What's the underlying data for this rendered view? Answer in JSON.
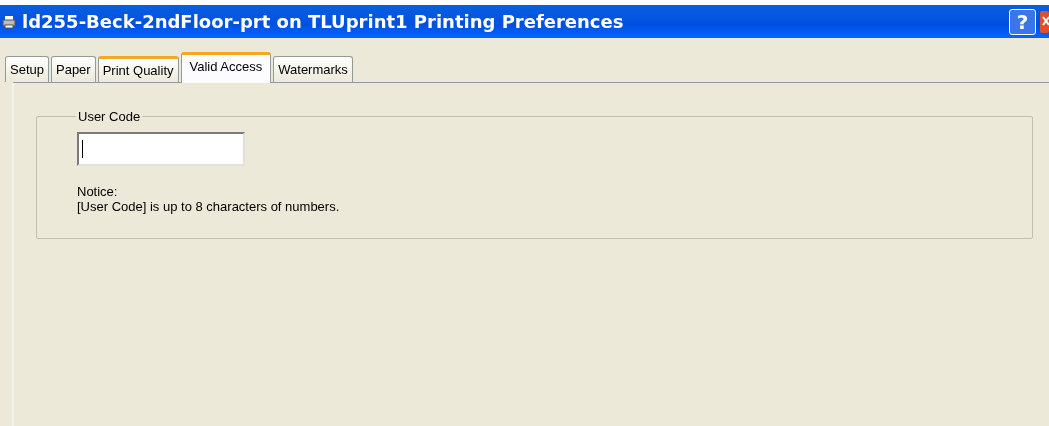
{
  "window": {
    "title": "ld255-Beck-2ndFloor-prt on TLUprint1 Printing Preferences",
    "help_button": "?"
  },
  "tabs": [
    {
      "label": "Setup",
      "selected": false,
      "hot": false
    },
    {
      "label": "Paper",
      "selected": false,
      "hot": false
    },
    {
      "label": "Print Quality",
      "selected": false,
      "hot": true
    },
    {
      "label": "Valid Access",
      "selected": true,
      "hot": false
    },
    {
      "label": "Watermarks",
      "selected": false,
      "hot": false
    }
  ],
  "group": {
    "title": "User Code",
    "field": {
      "focused": true
    },
    "notice_title": "Notice:",
    "notice_text": "[User Code] is up to 8 characters of numbers."
  }
}
